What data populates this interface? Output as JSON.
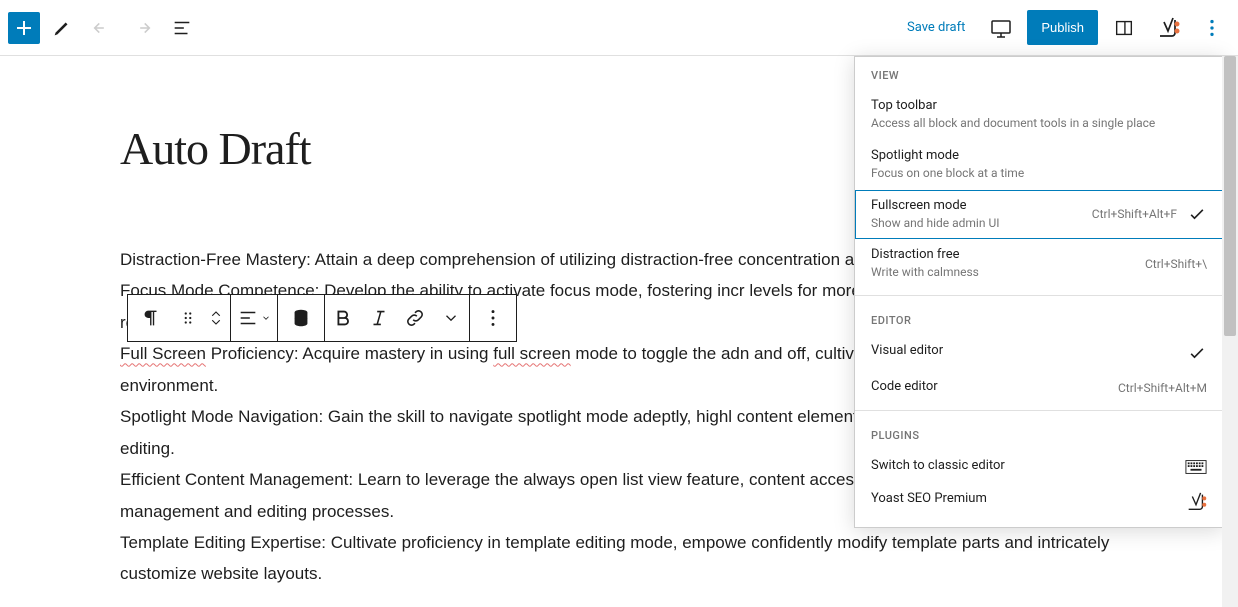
{
  "topbar": {
    "save_draft": "Save draft",
    "publish": "Publish"
  },
  "post": {
    "title": "Auto Draft",
    "paragraphs": [
      "Distraction-Free Mastery: Attain a deep comprehension of utilizing distraction-free concentration and streamline content generation.",
      "Focus Mode Competence: Develop the ability to activate focus mode, fostering incr levels for more effective editing and content refinement.",
      "<span class='spell'>Full Screen</span> Proficiency: Acquire mastery in using <span class='spell'>full screen</span> mode to toggle the adn and off, cultivating an immersive editing environment.",
      "Spotlight Mode Navigation: Gain the skill to navigate spotlight mode adeptly, highl content elements for meticulous and targeted editing.",
      "Efficient Content Management: Learn to leverage the always open list view feature, content accessibility and thereby enhancing management and editing processes.",
      "Template Editing Expertise: Cultivate proficiency in template editing mode, empowe confidently modify template parts and intricately customize website layouts."
    ]
  },
  "menu": {
    "sections": {
      "view": {
        "heading": "VIEW",
        "items": [
          {
            "title": "Top toolbar",
            "desc": "Access all block and document tools in a single place"
          },
          {
            "title": "Spotlight mode",
            "desc": "Focus on one block at a time"
          },
          {
            "title": "Fullscreen mode",
            "desc": "Show and hide admin UI",
            "shortcut": "Ctrl+Shift+Alt+F",
            "checked": true
          },
          {
            "title": "Distraction free",
            "desc": "Write with calmness",
            "shortcut": "Ctrl+Shift+\\"
          }
        ]
      },
      "editor": {
        "heading": "EDITOR",
        "items": [
          {
            "title": "Visual editor",
            "checked": true
          },
          {
            "title": "Code editor",
            "shortcut": "Ctrl+Shift+Alt+M"
          }
        ]
      },
      "plugins": {
        "heading": "PLUGINS",
        "items": [
          {
            "title": "Switch to classic editor"
          },
          {
            "title": "Yoast SEO Premium"
          }
        ]
      }
    }
  }
}
